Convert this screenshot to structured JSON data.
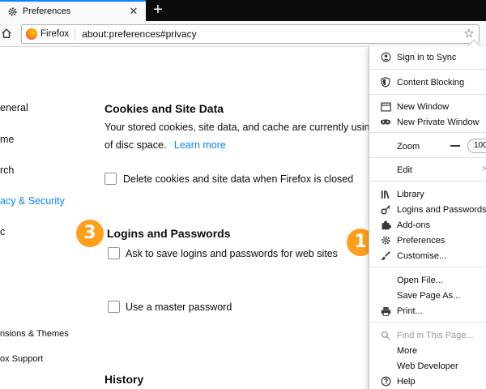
{
  "tab": {
    "title": "Preferences",
    "close": "✕"
  },
  "newtab": "+",
  "urlbar": {
    "identity": "Firefox",
    "url": "about:preferences#privacy",
    "star": "☆"
  },
  "sidebar": {
    "items": [
      {
        "label": "eneral"
      },
      {
        "label": "me"
      },
      {
        "label": "rch"
      },
      {
        "label": "acy & Security"
      },
      {
        "label": "c"
      },
      {
        "label": "nsions & Themes"
      },
      {
        "label": "ox Support"
      }
    ]
  },
  "cookies": {
    "title": "Cookies and Site Data",
    "desc1": "Your stored cookies, site data, and cache are currently usin",
    "desc2": "of disc space.",
    "learn_more": "Learn more",
    "checkbox": "Delete cookies and site data when Firefox is closed"
  },
  "logins": {
    "title": "Logins and Passwords",
    "ask": "Ask to save logins and passwords for web sites",
    "master": "Use a master password"
  },
  "history": {
    "title": "History"
  },
  "badges": {
    "left": "3",
    "right": "1",
    "color": "#ff9f1c"
  },
  "menu": {
    "sign_in": "Sign in to Sync",
    "content_blocking": "Content Blocking",
    "new_window": "New Window",
    "new_private": "New Private Window",
    "zoom": "Zoom",
    "zoom_value": "100",
    "edit": "Edit",
    "library": "Library",
    "logins": "Logins and Passwords",
    "addons": "Add-ons",
    "preferences": "Preferences",
    "customise": "Customise...",
    "open_file": "Open File...",
    "save_page": "Save Page As...",
    "print": "Print...",
    "find": "Find in This Page...",
    "more": "More",
    "web_dev": "Web Developer",
    "help": "Help"
  },
  "colors": {
    "accent": "#0a84ff",
    "tabstrip": "#0c0c0d"
  }
}
